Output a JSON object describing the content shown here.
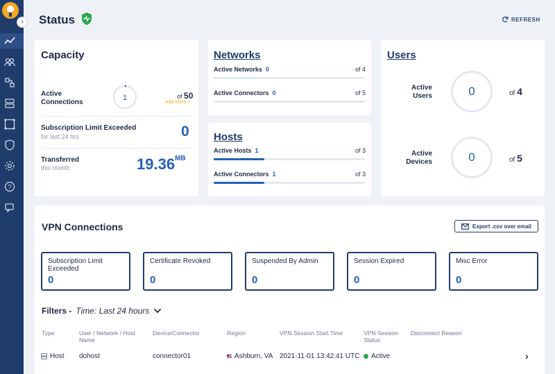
{
  "header": {
    "title": "Status",
    "refresh_label": "REFRESH"
  },
  "capacity": {
    "title": "Capacity",
    "active_connections_label": "Active Connections",
    "active_connections_value": "1",
    "active_connections_fraction": 0.02,
    "of_prefix": "of",
    "max_connections": "50",
    "add_more": "Add More +",
    "limit_exceeded_label": "Subscription Limit Exceeded",
    "limit_exceeded_sub": "for last 24 hrs",
    "limit_exceeded_value": "0",
    "transferred_label": "Transferred",
    "transferred_sub": "this month",
    "transferred_value": "19.36",
    "transferred_unit": "MB"
  },
  "networks": {
    "title": "Networks",
    "rows": [
      {
        "label": "Active Networks",
        "value": "0",
        "of": "of 4",
        "fraction": 0
      },
      {
        "label": "Active Connectors",
        "value": "0",
        "of": "of 5",
        "fraction": 0
      }
    ]
  },
  "hosts": {
    "title": "Hosts",
    "rows": [
      {
        "label": "Active Hosts",
        "value": "1",
        "of": "of 3",
        "fraction": 0.333
      },
      {
        "label": "Active Connectors",
        "value": "1",
        "of": "of 3",
        "fraction": 0.333
      }
    ]
  },
  "users": {
    "title": "Users",
    "active_users_label": "Active Users",
    "active_users_value": "0",
    "active_users_of_prefix": "of",
    "active_users_total": "4",
    "active_devices_label": "Active Devices",
    "active_devices_value": "0",
    "active_devices_of_prefix": "of",
    "active_devices_total": "5"
  },
  "vpn": {
    "title": "VPN Connections",
    "export_label": "Export .csv over email",
    "stats": [
      {
        "label": "Subscription Limit Exceeded",
        "value": "0"
      },
      {
        "label": "Certificate Revoked",
        "value": "0"
      },
      {
        "label": "Suspended By Admin",
        "value": "0"
      },
      {
        "label": "Session Expired",
        "value": "0"
      },
      {
        "label": "Misc Error",
        "value": "0"
      }
    ],
    "filters_label": "Filters -",
    "filters_time": "Time: Last 24 hours",
    "columns": [
      "Type",
      "User / Network / Host Name",
      "Device/Connector",
      "Region",
      "VPN Session Start Time",
      "VPN Session Status",
      "Disconnect Reason"
    ],
    "rows": [
      {
        "type": "Host",
        "name": "dohost",
        "device": "connector01",
        "region": "Ashburn, VA",
        "start": "2021-11-01 13:42:41 UTC",
        "status": "Active",
        "reason": ""
      }
    ]
  },
  "colors": {
    "sidebar": "#1f3c6b",
    "accent": "#2461b4",
    "orange": "#f5a623",
    "green": "#2ea44f",
    "background": "#eef2f7"
  },
  "icons": [
    "logo",
    "chevron-right-icon",
    "activity-icon",
    "users-icon",
    "network-icon",
    "server-icon",
    "nodes-icon",
    "shield-icon",
    "gear-icon",
    "help-icon",
    "chat-icon",
    "refresh-icon",
    "mail-icon",
    "chevron-down-icon",
    "host-icon",
    "us-flag-icon"
  ]
}
